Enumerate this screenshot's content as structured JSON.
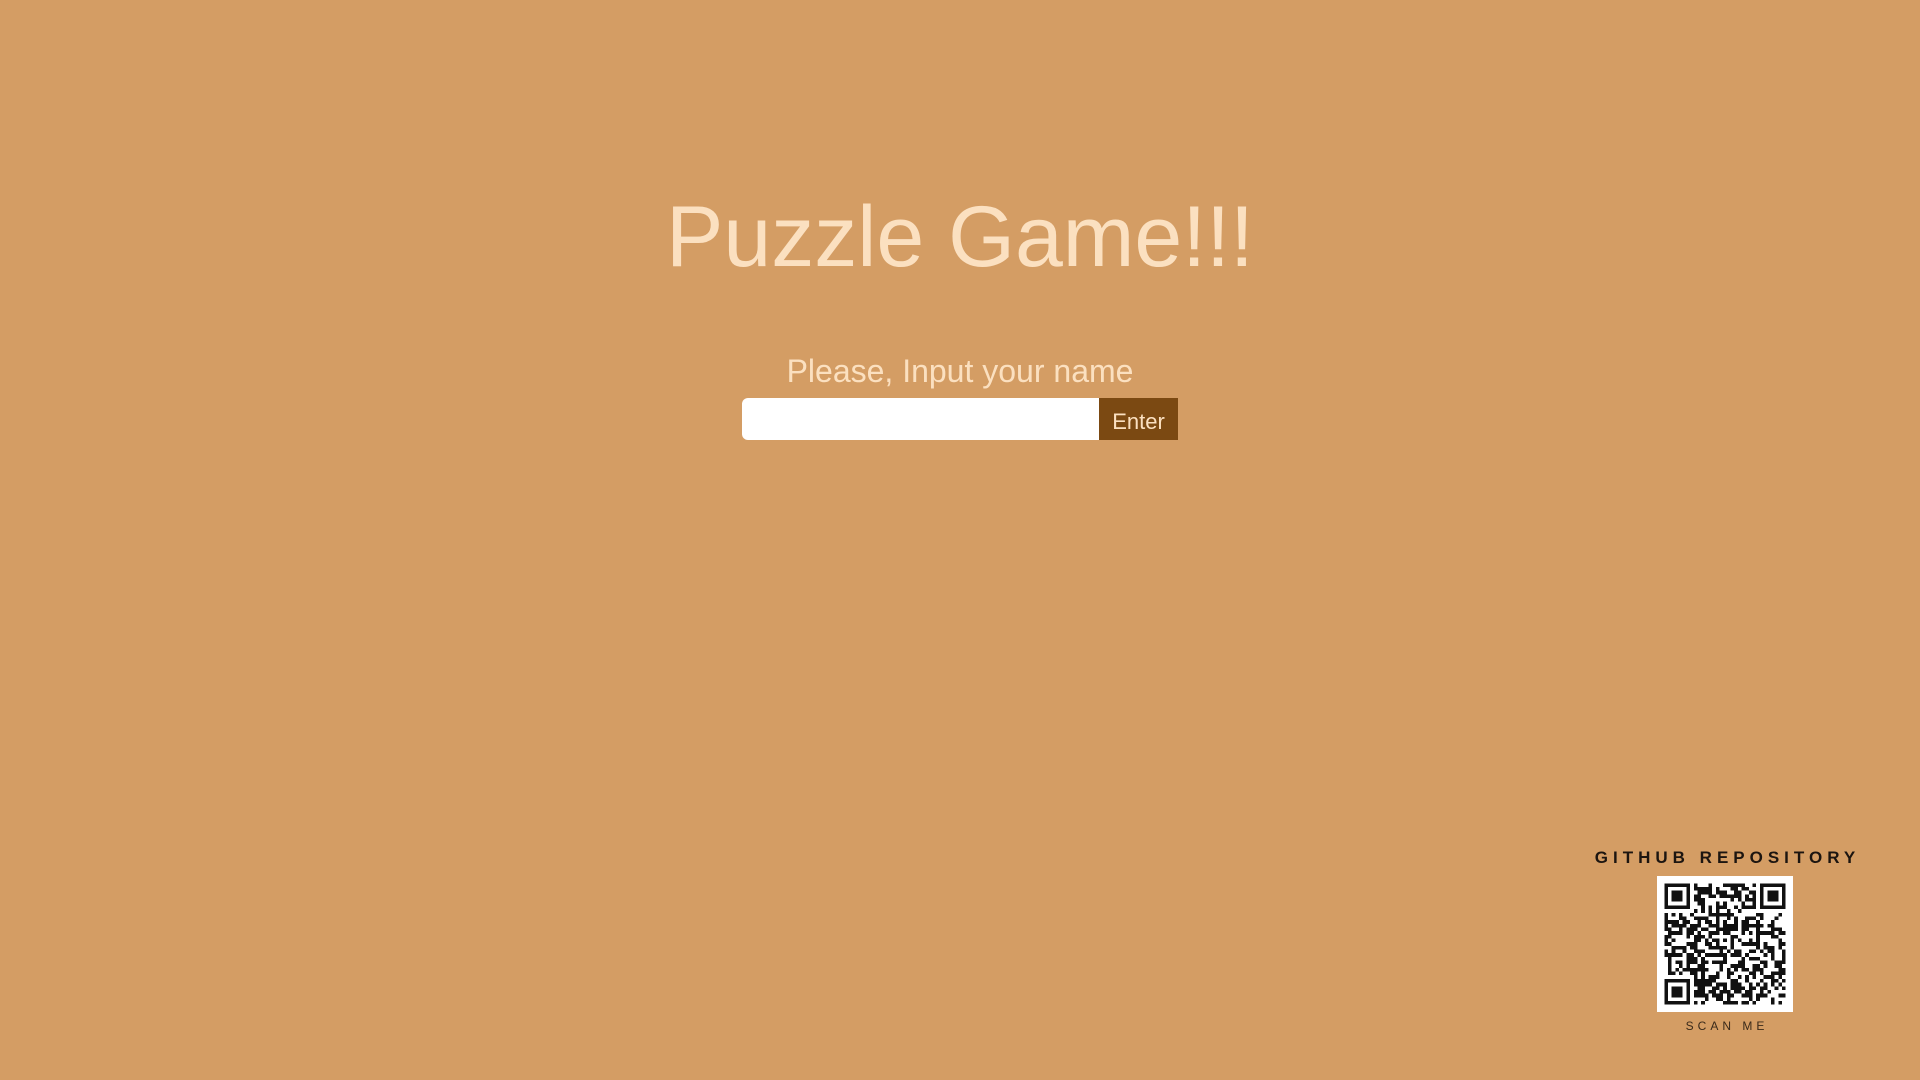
{
  "app": {
    "title": "Puzzle Game!!!"
  },
  "form": {
    "prompt": "Please, Input your name",
    "name_value": "",
    "name_placeholder": "",
    "enter_label": "Enter"
  },
  "repo": {
    "title": "GITHUB REPOSITORY",
    "scan_label": "SCAN ME"
  },
  "colors": {
    "background": "#d49d64",
    "title_text": "#fbe0c0",
    "button": "#7b4912",
    "input_bg": "#ffffff"
  }
}
